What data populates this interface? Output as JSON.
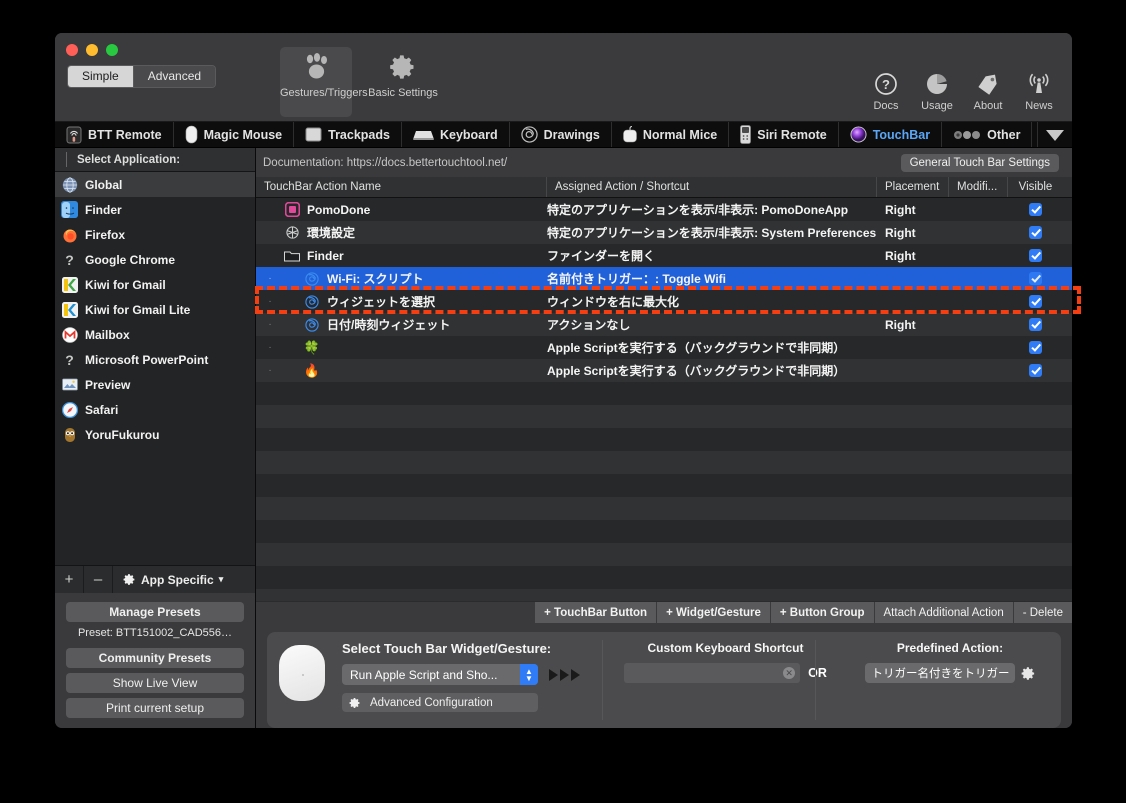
{
  "window": {
    "traffic_lights": [
      "close",
      "minimize",
      "zoom"
    ]
  },
  "toolbar": {
    "mode_segments": [
      {
        "label": "Simple",
        "active": true
      },
      {
        "label": "Advanced",
        "active": false
      }
    ],
    "items": [
      {
        "label": "Gestures/Triggers",
        "icon": "paw-icon",
        "selected": true
      },
      {
        "label": "Basic Settings",
        "icon": "gear-icon",
        "selected": false
      }
    ],
    "right_items": [
      {
        "label": "Docs",
        "icon": "question-circle-icon"
      },
      {
        "label": "Usage",
        "icon": "pie-chart-icon"
      },
      {
        "label": "About",
        "icon": "tag-icon"
      },
      {
        "label": "News",
        "icon": "broadcast-icon"
      }
    ]
  },
  "device_tabs": [
    {
      "label": "BTT Remote",
      "icon": "btt-remote-icon",
      "active": false
    },
    {
      "label": "Magic Mouse",
      "icon": "magic-mouse-icon",
      "active": false
    },
    {
      "label": "Trackpads",
      "icon": "trackpad-icon",
      "active": false
    },
    {
      "label": "Keyboard",
      "icon": "keyboard-icon",
      "active": false
    },
    {
      "label": "Drawings",
      "icon": "spiral-icon",
      "active": false
    },
    {
      "label": "Normal Mice",
      "icon": "mouse-icon",
      "active": false
    },
    {
      "label": "Siri Remote",
      "icon": "siri-remote-icon",
      "active": false
    },
    {
      "label": "TouchBar",
      "icon": "touchbar-orb-icon",
      "active": true
    },
    {
      "label": "Other",
      "icon": "dots-icon",
      "active": false
    }
  ],
  "sidebar": {
    "header": "Select Application:",
    "apps": [
      {
        "label": "Global",
        "icon": "globe-icon",
        "selected": true
      },
      {
        "label": "Finder",
        "icon": "finder-icon",
        "selected": false
      },
      {
        "label": "Firefox",
        "icon": "firefox-icon",
        "selected": false
      },
      {
        "label": "Google Chrome",
        "icon": "unknown-app-icon",
        "selected": false
      },
      {
        "label": "Kiwi for Gmail",
        "icon": "kiwi-icon",
        "selected": false
      },
      {
        "label": "Kiwi for Gmail Lite",
        "icon": "kiwi-lite-icon",
        "selected": false
      },
      {
        "label": "Mailbox",
        "icon": "mailbox-icon",
        "selected": false
      },
      {
        "label": "Microsoft PowerPoint",
        "icon": "unknown-app-icon",
        "selected": false
      },
      {
        "label": "Preview",
        "icon": "preview-icon",
        "selected": false
      },
      {
        "label": "Safari",
        "icon": "safari-icon",
        "selected": false
      },
      {
        "label": "YoruFukurou",
        "icon": "owl-icon",
        "selected": false
      }
    ],
    "toolbar": {
      "add": "+",
      "remove": "–",
      "scope_label": "App Specific",
      "scope_caret": "▾"
    },
    "buttons": {
      "manage_presets": "Manage Presets",
      "preset_line": "Preset: BTT151002_CAD556…",
      "community_presets": "Community Presets",
      "show_live_view": "Show Live View",
      "print_current_setup": "Print current setup"
    }
  },
  "main": {
    "documentation": "Documentation: https://docs.bettertouchtool.net/",
    "general_settings_button": "General Touch Bar Settings",
    "columns": [
      "TouchBar Action Name",
      "Assigned Action / Shortcut",
      "Placement",
      "Modifi...",
      "Visible"
    ],
    "rows": [
      {
        "icon": "pomodone-icon",
        "name": "PomoDone",
        "action": "特定のアプリケーションを表示/非表示: PomoDoneApp",
        "placement": "Right",
        "modifier": "",
        "visible": true,
        "indent": false,
        "selected": false
      },
      {
        "icon": "settings-gear-icon",
        "name": "環境設定",
        "action": "特定のアプリケーションを表示/非表示: System Preferences",
        "placement": "Right",
        "modifier": "",
        "visible": true,
        "indent": false,
        "selected": false
      },
      {
        "icon": "finder-folder-icon",
        "name": "Finder",
        "action": "ファインダーを開く",
        "placement": "Right",
        "modifier": "",
        "visible": true,
        "indent": false,
        "selected": false
      },
      {
        "icon": "spiral-blue-icon",
        "name": "Wi-Fi: スクリプト",
        "action": "名前付きトリガー：: Toggle Wifi",
        "placement": "",
        "modifier": "",
        "visible": true,
        "indent": true,
        "selected": true
      },
      {
        "icon": "spiral-blue-icon",
        "name": "ウィジェットを選択",
        "action": "ウィンドウを右に最大化",
        "placement": "",
        "modifier": "",
        "visible": true,
        "indent": true,
        "selected": false
      },
      {
        "icon": "spiral-blue-icon",
        "name": "日付/時刻ウィジェット",
        "action": "アクションなし",
        "placement": "Right",
        "modifier": "",
        "visible": true,
        "indent": true,
        "selected": false
      },
      {
        "icon": "clover-icon",
        "name": "",
        "action": "Apple Scriptを実行する（バックグラウンドで非同期）",
        "placement": "",
        "modifier": "",
        "visible": true,
        "indent": true,
        "selected": false
      },
      {
        "icon": "fire-icon",
        "name": "",
        "action": "Apple Scriptを実行する（バックグラウンドで非同期）",
        "placement": "",
        "modifier": "",
        "visible": true,
        "indent": true,
        "selected": false
      }
    ],
    "empty_row_count": 13,
    "action_buttons": [
      {
        "label": "+ TouchBar Button",
        "bold": true
      },
      {
        "label": "+ Widget/Gesture",
        "bold": true
      },
      {
        "label": "+ Button Group",
        "bold": true
      },
      {
        "label": "Attach Additional Action",
        "bold": false
      },
      {
        "label": "- Delete",
        "bold": false
      }
    ]
  },
  "detail_panel": {
    "widget_title": "Select Touch Bar Widget/Gesture:",
    "widget_value": "Run Apple Script and Sho...",
    "advanced_config_label": "Advanced Configuration",
    "advanced_config_icon": "gear-icon",
    "shortcut_title": "Custom Keyboard Shortcut",
    "shortcut_value": "",
    "shortcut_clear_icon": "clear-x-icon",
    "or_label": "OR",
    "predefined_title": "Predefined Action:",
    "predefined_value": "トリガー名付きをトリガー（",
    "predefined_gear_icon": "gear-icon"
  },
  "annotation": {
    "color": "#f53f12",
    "style": "dashed-rectangle",
    "target_row": "Wi-Fi: スクリプト"
  },
  "colors": {
    "selection_blue": "#2060d8",
    "active_tab_blue": "#5ba7f7",
    "checkbox_blue": "#2f7cf6",
    "annotation_red": "#f53f12",
    "window_chrome": "#3a3a3c",
    "table_row_dark": "#262829",
    "table_row_light": "#303234"
  }
}
